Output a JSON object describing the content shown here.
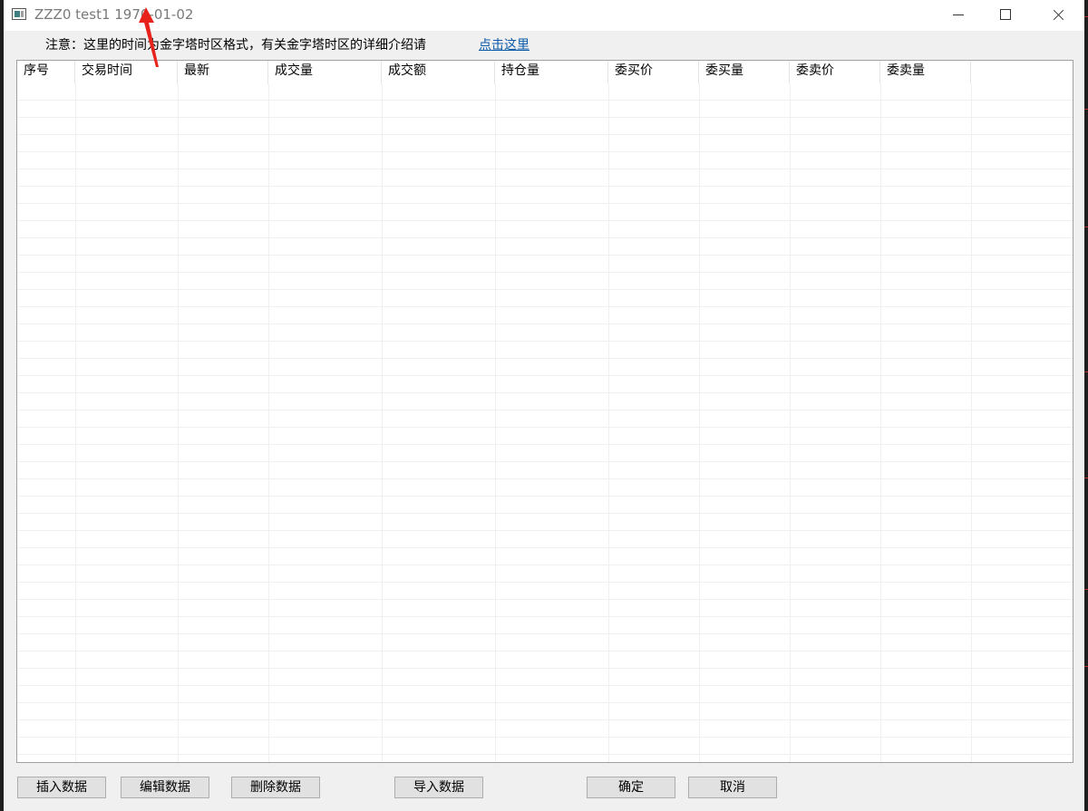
{
  "window": {
    "title": "ZZZ0 test1 1970-01-02",
    "controls": {
      "minimize": "minimize-icon",
      "maximize": "maximize-icon",
      "close": "close-icon"
    }
  },
  "notice": {
    "text": "注意：这里的时间为金字塔时区格式，有关金字塔时区的详细介绍请",
    "link": "点击这里"
  },
  "table": {
    "columns": [
      "序号",
      "交易时间",
      "最新",
      "成交量",
      "成交额",
      "持仓量",
      "委买价",
      "委买量",
      "委卖价",
      "委卖量"
    ],
    "rows": []
  },
  "buttons": {
    "insert": "插入数据",
    "edit": "编辑数据",
    "delete": "删除数据",
    "import": "导入数据",
    "ok": "确定",
    "cancel": "取消"
  },
  "colors": {
    "annotation_arrow": "#e8231c",
    "link": "#0b5aa8",
    "button_bg": "#e1e1e1"
  }
}
